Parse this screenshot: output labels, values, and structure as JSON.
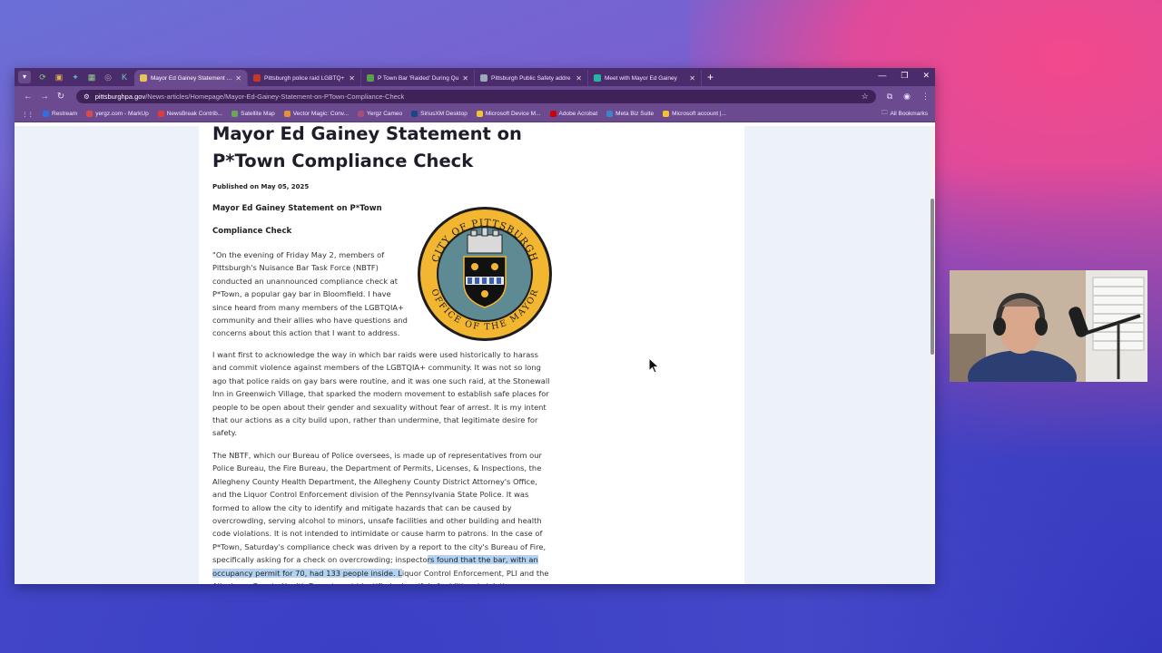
{
  "browser": {
    "tabs": [
      {
        "title": "Mayor Ed Gainey Statement on",
        "color": "#e8c35a",
        "active": true
      },
      {
        "title": "Pittsburgh police raid LGBTQ+",
        "color": "#c0392b",
        "active": false
      },
      {
        "title": "P Town Bar 'Raided' During Qu",
        "color": "#5aa04a",
        "active": false
      },
      {
        "title": "Pittsburgh Public Safety addre",
        "color": "#9ab",
        "active": false
      },
      {
        "title": "Meet with Mayor Ed Gainey",
        "color": "#2ab3a3",
        "active": false
      }
    ],
    "url_host": "pittsburghpa.gov",
    "url_path": "/News-articles/Homepage/Mayor-Ed-Gainey-Statement-on-PTown-Compliance-Check",
    "bookmarks": [
      {
        "label": "Restream",
        "color": "#2f6fe0"
      },
      {
        "label": "yergz.com - MarkUp",
        "color": "#d94b4b"
      },
      {
        "label": "NewsBreak Contrib...",
        "color": "#e03a3a"
      },
      {
        "label": "Satellite Map",
        "color": "#6aa84f"
      },
      {
        "label": "Vector Magic: Conv...",
        "color": "#e69138"
      },
      {
        "label": "Yergz Cameo",
        "color": "#a64d79"
      },
      {
        "label": "SiriusXM Desktop",
        "color": "#1c4587"
      },
      {
        "label": "Microsoft Device M...",
        "color": "#f1c232"
      },
      {
        "label": "Adobe Acrobat",
        "color": "#cc0000"
      },
      {
        "label": "Meta Biz Suite",
        "color": "#3d85c6"
      },
      {
        "label": "Microsoft account |...",
        "color": "#f1c232"
      }
    ],
    "all_bookmarks": "All Bookmarks"
  },
  "article": {
    "title": "Mayor Ed Gainey Statement on P*Town Compliance Check",
    "published": "Published on May 05, 2025",
    "subhead_1": "Mayor Ed Gainey Statement on P*Town",
    "subhead_2": "Compliance Check",
    "para_1": "\"On the evening of Friday May 2, members of Pittsburgh's Nuisance Bar Task Force (NBTF) conducted an unannounced compliance check at P*Town, a popular gay bar in Bloomfield. I have since heard from many members of the LGBTQIA+ community and their allies who have questions and concerns about this action that I want to address.",
    "para_2": "I want first to acknowledge the way in which bar raids were used historically to harass and commit violence against members of the LGBTQIA+ community. It was not so long ago that police raids on gay bars were routine, and it was one such raid, at the Stonewall Inn in Greenwich Village, that sparked the modern movement to establish safe places for people to be open about their gender and sexuality without fear of arrest. It is my intent that our actions as a city build upon, rather than undermine, that legitimate desire for safety.",
    "para_3_a": "The NBTF, which our Bureau of Police oversees, is made up of representatives from our Police Bureau, the Fire Bureau, the Department of Permits, Licenses, & Inspections, the Allegheny County Health Department, the Allegheny County District Attorney's Office, and the Liquor Control Enforcement division of the Pennsylvania State Police. It was formed to allow the city to identify and mitigate hazards that can be caused by overcrowding, serving alcohol to minors, unsafe facilities and other building and health code violations. It is not intended to intimidate or cause harm to patrons. In the case of P*Town, Saturday's compliance check was driven by a report to the city's Bureau of Fire, specifically asking for a check on overcrowding; inspecto",
    "para_3_highlight": "rs found that the bar, with an occupancy permit for 70, had 133 people inside. L",
    "para_3_b": "iquor Control Enforcement, PLI and the Allegheny County Health Department identified a handful of additional violations",
    "seal_top": "CITY OF PITTSBURGH",
    "seal_bottom": "OFFICE OF THE MAYOR"
  }
}
